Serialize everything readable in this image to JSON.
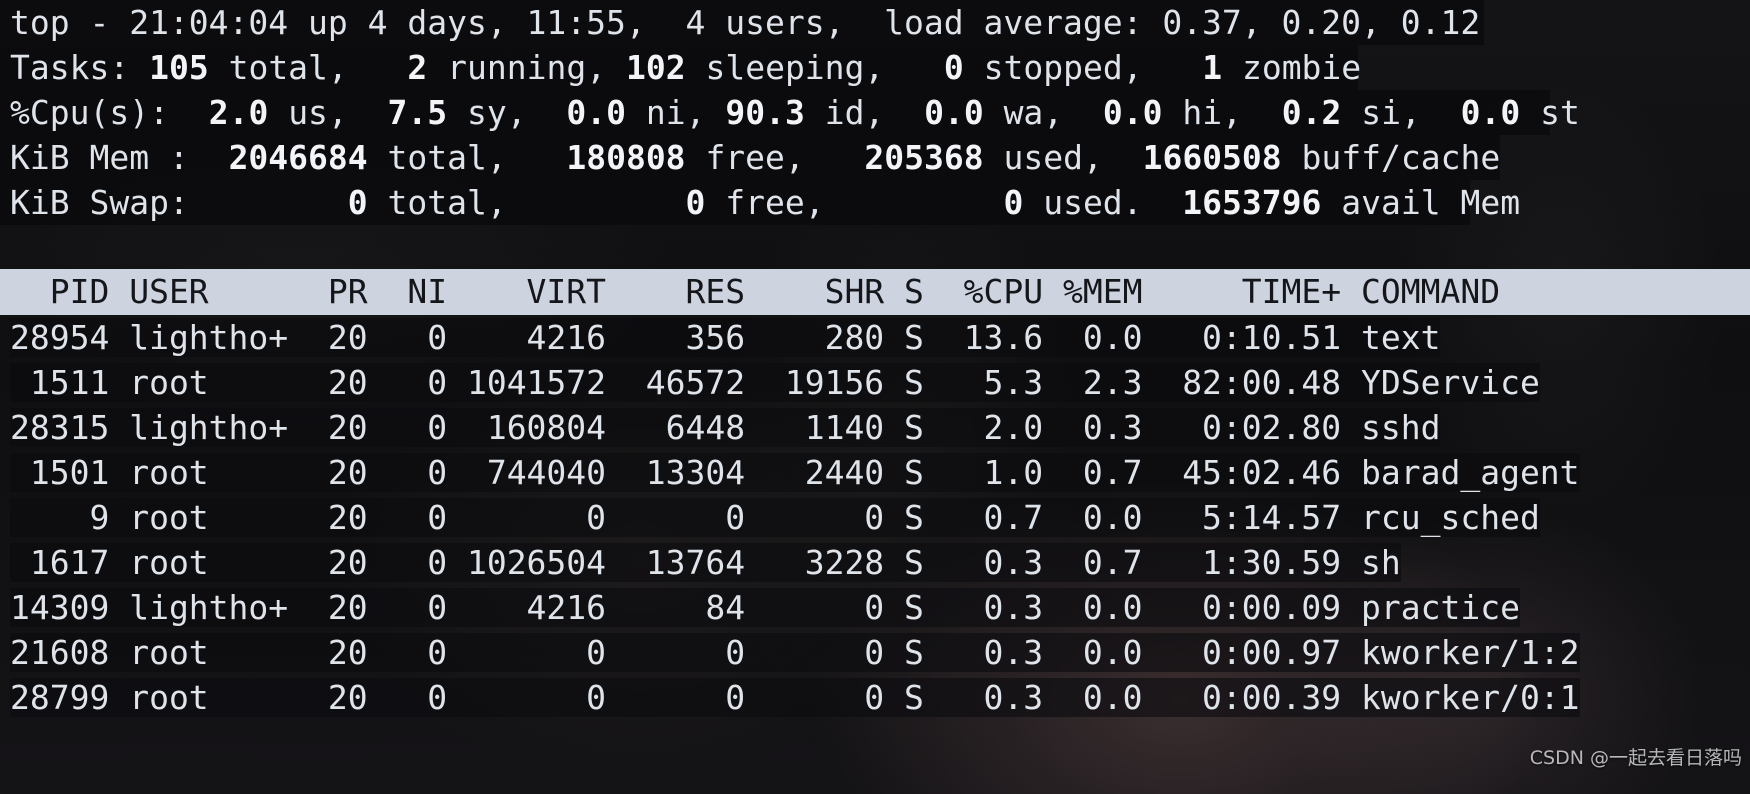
{
  "terminal": {
    "program": "top",
    "background_color": "#121214",
    "text_color": "#dfe3ea",
    "header_bar_color": "#ced3e0",
    "header_text_color": "#14161a"
  },
  "summary": {
    "uptime_line": {
      "program": "top",
      "dash": "-",
      "time": "21:04:04",
      "up_label": "up",
      "uptime": "4 days, 11:55,",
      "users": "4 users,",
      "load_label": "load average:",
      "load_1": "0.37,",
      "load_5": "0.20,",
      "load_15": "0.12",
      "full": "top - 21:04:04 up 4 days, 11:55,  4 users,  load average: 0.37, 0.20, 0.12"
    },
    "tasks_line": {
      "label": "Tasks:",
      "total": "105",
      "total_label": "total,",
      "running": "2",
      "running_label": "running,",
      "sleeping": "102",
      "sleeping_label": "sleeping,",
      "stopped": "0",
      "stopped_label": "stopped,",
      "zombie": "1",
      "zombie_label": "zombie"
    },
    "cpu_line": {
      "label": "%Cpu(s):",
      "us": "2.0",
      "us_label": "us,",
      "sy": "7.5",
      "sy_label": "sy,",
      "ni": "0.0",
      "ni_label": "ni,",
      "id": "90.3",
      "id_label": "id,",
      "wa": "0.0",
      "wa_label": "wa,",
      "hi": "0.0",
      "hi_label": "hi,",
      "si": "0.2",
      "si_label": "si,",
      "st": "0.0",
      "st_label": "st"
    },
    "mem_line": {
      "label": "KiB Mem :",
      "total": "2046684",
      "total_label": "total,",
      "free": "180808",
      "free_label": "free,",
      "used": "205368",
      "used_label": "used,",
      "buff_cache": "1660508",
      "buff_cache_label": "buff/cache"
    },
    "swap_line": {
      "label": "KiB Swap:",
      "total": "0",
      "total_label": "total,",
      "free": "0",
      "free_label": "free,",
      "used": "0",
      "used_label": "used.",
      "avail": "1653796",
      "avail_label": "avail Mem"
    }
  },
  "table": {
    "columns": [
      "PID",
      "USER",
      "PR",
      "NI",
      "VIRT",
      "RES",
      "SHR",
      "S",
      "%CPU",
      "%MEM",
      "TIME+",
      "COMMAND"
    ],
    "header_line": "  PID USER      PR  NI    VIRT    RES    SHR S  %CPU %MEM     TIME+ COMMAND",
    "rows": [
      {
        "pid": "28954",
        "user": "lightho+",
        "pr": "20",
        "ni": "0",
        "virt": "4216",
        "res": "356",
        "shr": "280",
        "s": "S",
        "cpu": "13.6",
        "mem": "0.0",
        "time": "0:10.51",
        "command": "text",
        "line": "28954 lightho+  20   0    4216    356    280 S  13.6  0.0   0:10.51 text"
      },
      {
        "pid": "1511",
        "user": "root",
        "pr": "20",
        "ni": "0",
        "virt": "1041572",
        "res": "46572",
        "shr": "19156",
        "s": "S",
        "cpu": "5.3",
        "mem": "2.3",
        "time": "82:00.48",
        "command": "YDService",
        "line": " 1511 root      20   0 1041572  46572  19156 S   5.3  2.3  82:00.48 YDService"
      },
      {
        "pid": "28315",
        "user": "lightho+",
        "pr": "20",
        "ni": "0",
        "virt": "160804",
        "res": "6448",
        "shr": "1140",
        "s": "S",
        "cpu": "2.0",
        "mem": "0.3",
        "time": "0:02.80",
        "command": "sshd",
        "line": "28315 lightho+  20   0  160804   6448   1140 S   2.0  0.3   0:02.80 sshd"
      },
      {
        "pid": "1501",
        "user": "root",
        "pr": "20",
        "ni": "0",
        "virt": "744040",
        "res": "13304",
        "shr": "2440",
        "s": "S",
        "cpu": "1.0",
        "mem": "0.7",
        "time": "45:02.46",
        "command": "barad_agent",
        "line": " 1501 root      20   0  744040  13304   2440 S   1.0  0.7  45:02.46 barad_agent"
      },
      {
        "pid": "9",
        "user": "root",
        "pr": "20",
        "ni": "0",
        "virt": "0",
        "res": "0",
        "shr": "0",
        "s": "S",
        "cpu": "0.7",
        "mem": "0.0",
        "time": "5:14.57",
        "command": "rcu_sched",
        "line": "    9 root      20   0       0      0      0 S   0.7  0.0   5:14.57 rcu_sched"
      },
      {
        "pid": "1617",
        "user": "root",
        "pr": "20",
        "ni": "0",
        "virt": "1026504",
        "res": "13764",
        "shr": "3228",
        "s": "S",
        "cpu": "0.3",
        "mem": "0.7",
        "time": "1:30.59",
        "command": "sh",
        "line": " 1617 root      20   0 1026504  13764   3228 S   0.3  0.7   1:30.59 sh"
      },
      {
        "pid": "14309",
        "user": "lightho+",
        "pr": "20",
        "ni": "0",
        "virt": "4216",
        "res": "84",
        "shr": "0",
        "s": "S",
        "cpu": "0.3",
        "mem": "0.0",
        "time": "0:00.09",
        "command": "practice",
        "line": "14309 lightho+  20   0    4216     84      0 S   0.3  0.0   0:00.09 practice"
      },
      {
        "pid": "21608",
        "user": "root",
        "pr": "20",
        "ni": "0",
        "virt": "0",
        "res": "0",
        "shr": "0",
        "s": "S",
        "cpu": "0.3",
        "mem": "0.0",
        "time": "0:00.97",
        "command": "kworker/1:2",
        "line": "21608 root      20   0       0      0      0 S   0.3  0.0   0:00.97 kworker/1:2"
      },
      {
        "pid": "28799",
        "user": "root",
        "pr": "20",
        "ni": "0",
        "virt": "0",
        "res": "0",
        "shr": "0",
        "s": "S",
        "cpu": "0.3",
        "mem": "0.0",
        "time": "0:00.39",
        "command": "kworker/0:1",
        "line": "28799 root      20   0       0      0      0 S   0.3  0.0   0:00.39 kworker/0:1"
      }
    ]
  },
  "watermark": {
    "text": "CSDN @一起去看日落吗"
  }
}
